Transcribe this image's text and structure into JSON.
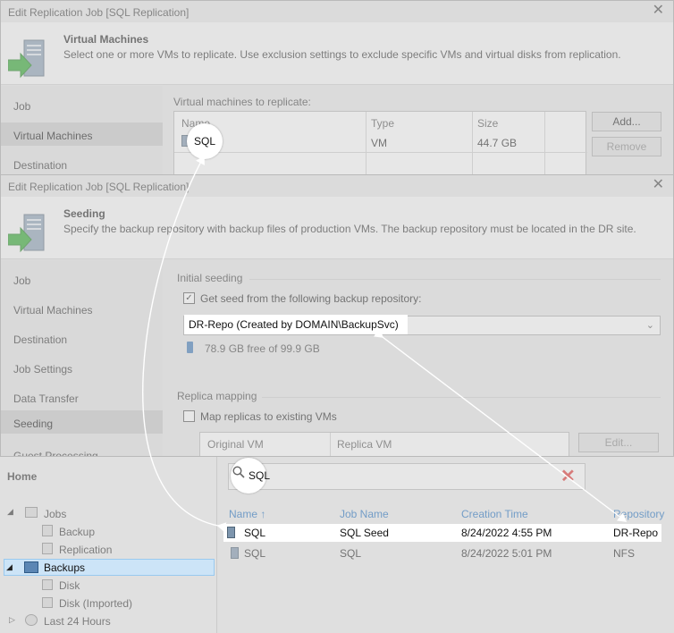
{
  "window1": {
    "title": "Edit Replication Job [SQL Replication]",
    "heading": "Virtual Machines",
    "description": "Select one or more VMs to replicate. Use exclusion settings to exclude specific VMs and virtual disks from replication.",
    "nav": [
      "Job",
      "Virtual Machines",
      "Destination"
    ],
    "selected_nav": "Virtual Machines",
    "section_label": "Virtual machines to replicate:",
    "columns": [
      "Name",
      "Type",
      "Size"
    ],
    "rows": [
      {
        "name": "SQL",
        "type": "VM",
        "size": "44.7 GB"
      }
    ],
    "add_button": "Add...",
    "remove_button": "Remove",
    "callout": "SQL"
  },
  "window2": {
    "title": "Edit Replication Job [SQL Replication]",
    "heading": "Seeding",
    "description": "Specify the backup repository with backup files of production VMs. The backup repository must be located in the DR site.",
    "nav": [
      "Job",
      "Virtual Machines",
      "Destination",
      "Job Settings",
      "Data Transfer",
      "Seeding",
      "Guest Processing"
    ],
    "selected_nav": "Seeding",
    "initial_seeding_label": "Initial seeding",
    "seed_checkbox_label": "Get seed from the following backup repository:",
    "seed_checked": true,
    "repository_value": "DR-Repo (Created by DOMAIN\\BackupSvc)",
    "free_space": "78.9 GB free of 99.9 GB",
    "replica_mapping_label": "Replica mapping",
    "map_checkbox_label": "Map replicas to existing VMs",
    "map_checked": false,
    "mapping_columns": [
      "Original VM",
      "Replica VM"
    ],
    "edit_button": "Edit..."
  },
  "console": {
    "home_label": "Home",
    "tree": {
      "jobs": "Jobs",
      "backup": "Backup",
      "replication": "Replication",
      "backups": "Backups",
      "disk": "Disk",
      "disk_imported": "Disk (Imported)",
      "last24": "Last 24 Hours"
    },
    "search_value": "SQL",
    "columns": [
      "Name",
      "Job Name",
      "Creation Time",
      "Repository"
    ],
    "sort_indicator": "↑",
    "rows": [
      {
        "name": "SQL",
        "job": "SQL Seed",
        "time": "8/24/2022 4:55 PM",
        "repo": "DR-Repo"
      },
      {
        "name": "SQL",
        "job": "SQL",
        "time": "8/24/2022 5:01 PM",
        "repo": "NFS"
      }
    ]
  },
  "colors": {
    "accent_link": "#1f70c1",
    "clear_search": "#e0312f",
    "wizard_arrow": "#2aa52a"
  }
}
